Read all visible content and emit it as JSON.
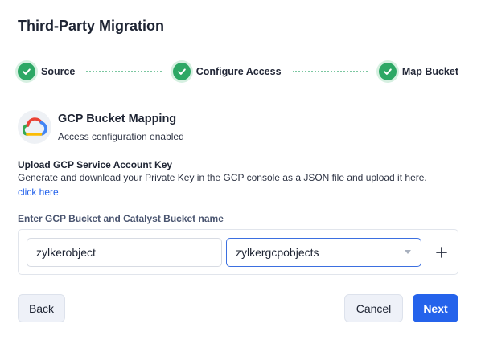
{
  "dialog": {
    "title": "Third-Party Migration"
  },
  "stepper": {
    "steps": [
      {
        "label": "Source",
        "status": "complete"
      },
      {
        "label": "Configure Access",
        "status": "complete"
      },
      {
        "label": "Map Bucket",
        "status": "complete"
      }
    ]
  },
  "mapping": {
    "title": "GCP Bucket Mapping",
    "subtitle": "Access configuration enabled",
    "icon": "gcp-cloud-logo"
  },
  "upload": {
    "title": "Upload GCP Service Account Key",
    "description": "Generate and download your Private Key in the GCP console as a JSON file and upload it here.",
    "link": "click here"
  },
  "bucket": {
    "label": "Enter GCP Bucket and Catalyst Bucket name",
    "gcp_value": "zylkerobject",
    "catalyst_value": "zylkergcpobjects"
  },
  "footer": {
    "back_label": "Back",
    "cancel_label": "Cancel",
    "next_label": "Next"
  },
  "colors": {
    "success": "#2da865",
    "primary": "#2563eb",
    "focus_border": "#3b6fe0"
  }
}
